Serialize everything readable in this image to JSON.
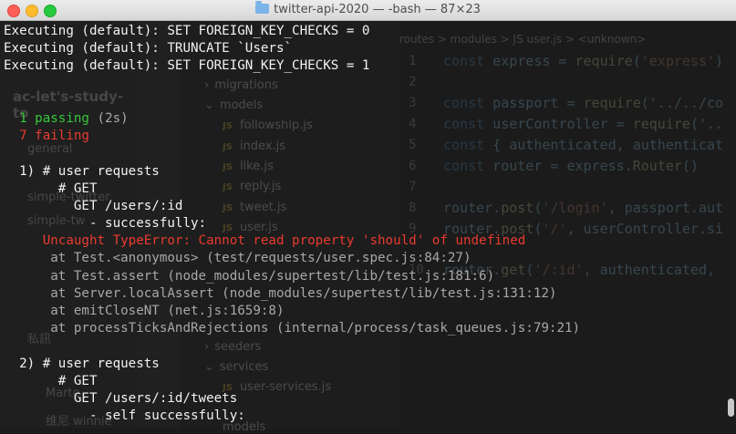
{
  "window": {
    "title": "twitter-api-2020 — -bash — 87×23"
  },
  "background_app": {
    "sidebar": {
      "workspace": "ac-let's-study-to",
      "items": [
        "general",
        "simple-twitter",
        "simple-tw",
        "私訊"
      ],
      "dms": [
        "Marte",
        "维尼 winnie"
      ]
    },
    "breadcrumb": "routes > modules > JS user.js > <unknown>",
    "tree": {
      "migrations": "migrations",
      "models": "models",
      "files": [
        "followship.js",
        "index.js",
        "like.js",
        "reply.js",
        "tweet.js",
        "user.js"
      ],
      "seeders": "seeders",
      "services": "services",
      "user_services": "user-services.js",
      "tests": "models"
    },
    "line_numbers": [
      "1",
      "2",
      "3",
      "4",
      "5",
      "6",
      "7",
      "8",
      "9",
      "10"
    ],
    "code_lines": [
      "const express = require('express')",
      "",
      "const passport = require('../../co",
      "const userController = require('..",
      "const { authenticated, authenticat",
      "const router = express.Router()",
      "",
      "router.post('/login', passport.aut",
      "router.post('/', userController.si",
      "router.get('/:id', authenticated, "
    ]
  },
  "terminal": {
    "lines": [
      {
        "text": "Executing (default): SET FOREIGN_KEY_CHECKS = 0",
        "color": "white"
      },
      {
        "text": "Executing (default): TRUNCATE `Users`",
        "color": "white"
      },
      {
        "text": "Executing (default): SET FOREIGN_KEY_CHECKS = 1",
        "color": "white"
      },
      {
        "text": "",
        "color": "white"
      },
      {
        "text": "",
        "color": "white"
      },
      {
        "text": "  1 passing",
        "color": "green",
        "suffix": " (2s)"
      },
      {
        "text": "  7 failing",
        "color": "red"
      },
      {
        "text": "",
        "color": "white"
      },
      {
        "text": "  1) # user requests",
        "color": "white"
      },
      {
        "text": "       # GET",
        "color": "white"
      },
      {
        "text": "         GET /users/:id",
        "color": "white"
      },
      {
        "text": "           - successfully:",
        "color": "white"
      },
      {
        "text": "     Uncaught TypeError: Cannot read property 'should' of undefined",
        "color": "red"
      },
      {
        "text": "      at Test.<anonymous> (test/requests/user.spec.js:84:27)",
        "color": "gray"
      },
      {
        "text": "      at Test.assert (node_modules/supertest/lib/test.js:181:6)",
        "color": "gray"
      },
      {
        "text": "      at Server.localAssert (node_modules/supertest/lib/test.js:131:12)",
        "color": "gray"
      },
      {
        "text": "      at emitCloseNT (net.js:1659:8)",
        "color": "gray"
      },
      {
        "text": "      at processTicksAndRejections (internal/process/task_queues.js:79:21)",
        "color": "gray"
      },
      {
        "text": "",
        "color": "white"
      },
      {
        "text": "  2) # user requests",
        "color": "white"
      },
      {
        "text": "       # GET",
        "color": "white"
      },
      {
        "text": "         GET /users/:id/tweets",
        "color": "white"
      },
      {
        "text": "           - self successfully:",
        "color": "white"
      }
    ]
  }
}
